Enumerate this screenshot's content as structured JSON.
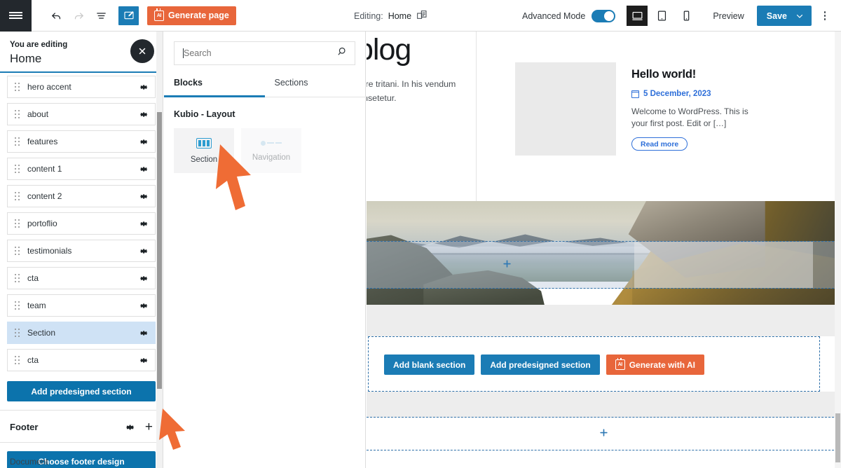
{
  "topbar": {
    "menu_icon": "hamburger-icon",
    "undo_icon": "undo-icon",
    "redo_icon": "redo-icon",
    "list_view_icon": "list-view-icon",
    "edit_icon": "edit-pencil-icon",
    "generate_page_label": "Generate page",
    "ai_badge_text": "AI",
    "editing_label": "Editing:",
    "editing_page": "Home",
    "page_switch_icon": "page-switch-icon",
    "advanced_mode_label": "Advanced Mode",
    "advanced_mode_on": true,
    "device_desktop_icon": "desktop-icon",
    "device_tablet_icon": "tablet-icon",
    "device_mobile_icon": "mobile-icon",
    "preview_label": "Preview",
    "save_label": "Save",
    "save_caret_icon": "chevron-down-icon",
    "more_icon": "kebab-menu-icon"
  },
  "sidebar": {
    "eyebrow": "You are editing",
    "page_name": "Home",
    "close_icon": "close-icon",
    "sections": [
      {
        "label": "hero accent",
        "selected": false
      },
      {
        "label": "about",
        "selected": false
      },
      {
        "label": "features",
        "selected": false
      },
      {
        "label": "content 1",
        "selected": false
      },
      {
        "label": "content 2",
        "selected": false
      },
      {
        "label": "portoflio",
        "selected": false
      },
      {
        "label": "testimonials",
        "selected": false
      },
      {
        "label": "cta",
        "selected": false
      },
      {
        "label": "team",
        "selected": false
      },
      {
        "label": "Section",
        "selected": true
      },
      {
        "label": "cta",
        "selected": false
      }
    ],
    "add_predesigned_label": "Add predesigned section",
    "footer_title": "Footer",
    "footer_gear_icon": "gear-icon",
    "footer_add_icon": "plus-icon",
    "choose_footer_label": "Choose footer design",
    "document_label": "Document"
  },
  "blocks_panel": {
    "search_placeholder": "Search",
    "search_value": "",
    "search_icon": "search-icon",
    "tabs": [
      {
        "label": "Blocks",
        "active": true
      },
      {
        "label": "Sections",
        "active": false
      }
    ],
    "group_title": "Kubio - Layout",
    "blocks": [
      {
        "label": "Section",
        "icon": "section-layout-icon",
        "disabled": false
      },
      {
        "label": "Navigation",
        "icon": "navigation-icon",
        "disabled": true
      }
    ]
  },
  "canvas": {
    "hero_title": "blog",
    "hero_subtitle": "olore tritani. In his vendum consetetur.",
    "post": {
      "thumbnail": "post-thumbnail-placeholder",
      "title": "Hello world!",
      "date_icon": "calendar-icon",
      "date": "5 December, 2023",
      "excerpt": "Welcome to WordPress. This is your first post. Edit or […]",
      "read_more_label": "Read more"
    },
    "photo_alt": "mountain-landscape-image",
    "selection_plus_icon": "plus-marker-icon",
    "add_zone": {
      "add_blank_label": "Add blank section",
      "add_predesigned_label": "Add predesigned section",
      "generate_ai_label": "Generate with AI",
      "ai_badge_text": "AI"
    },
    "bottom_plus_icon": "plus-marker-icon"
  },
  "colors": {
    "brand_blue": "#1b7cb5",
    "sidebar_blue": "#0c73ac",
    "accent_orange": "#e8663b",
    "dark": "#23282d",
    "selected_row": "#cfe2f5",
    "link_blue": "#2e6fd9"
  }
}
